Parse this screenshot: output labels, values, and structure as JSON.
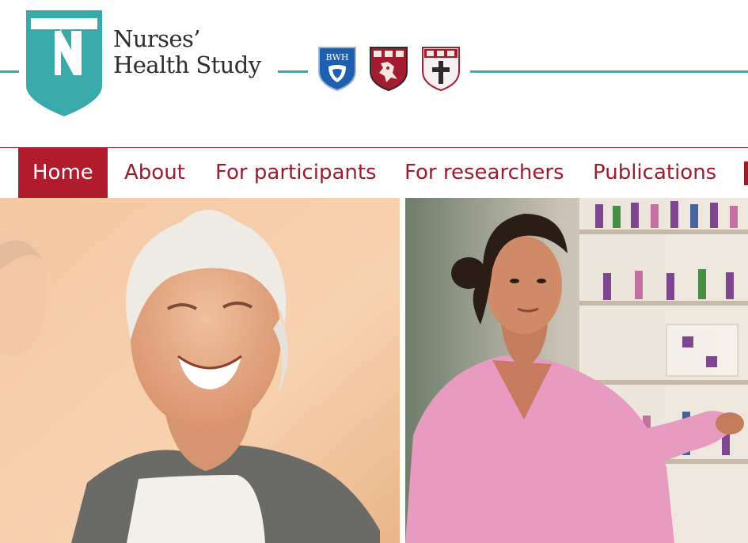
{
  "brand": {
    "name_line1": "Nurses’",
    "name_line2": "Health Study",
    "logo_letter": "N",
    "colors": {
      "teal": "#3aa9aa",
      "crimson": "#a31a2b",
      "text": "#2e2e2e"
    }
  },
  "partners": [
    {
      "label": "BWH",
      "icon": "bwh-shield-icon"
    },
    {
      "label": "",
      "icon": "harvard-chan-shield-icon"
    },
    {
      "label": "",
      "icon": "harvard-medical-shield-icon"
    }
  ],
  "nav": {
    "items": [
      {
        "label": "Home",
        "active": true
      },
      {
        "label": "About",
        "active": false
      },
      {
        "label": "For participants",
        "active": false
      },
      {
        "label": "For researchers",
        "active": false
      },
      {
        "label": "Publications",
        "active": false
      }
    ]
  },
  "hero": {
    "left_image": "smiling-older-woman-photo",
    "right_image": "nurse-at-records-shelf-photo"
  }
}
